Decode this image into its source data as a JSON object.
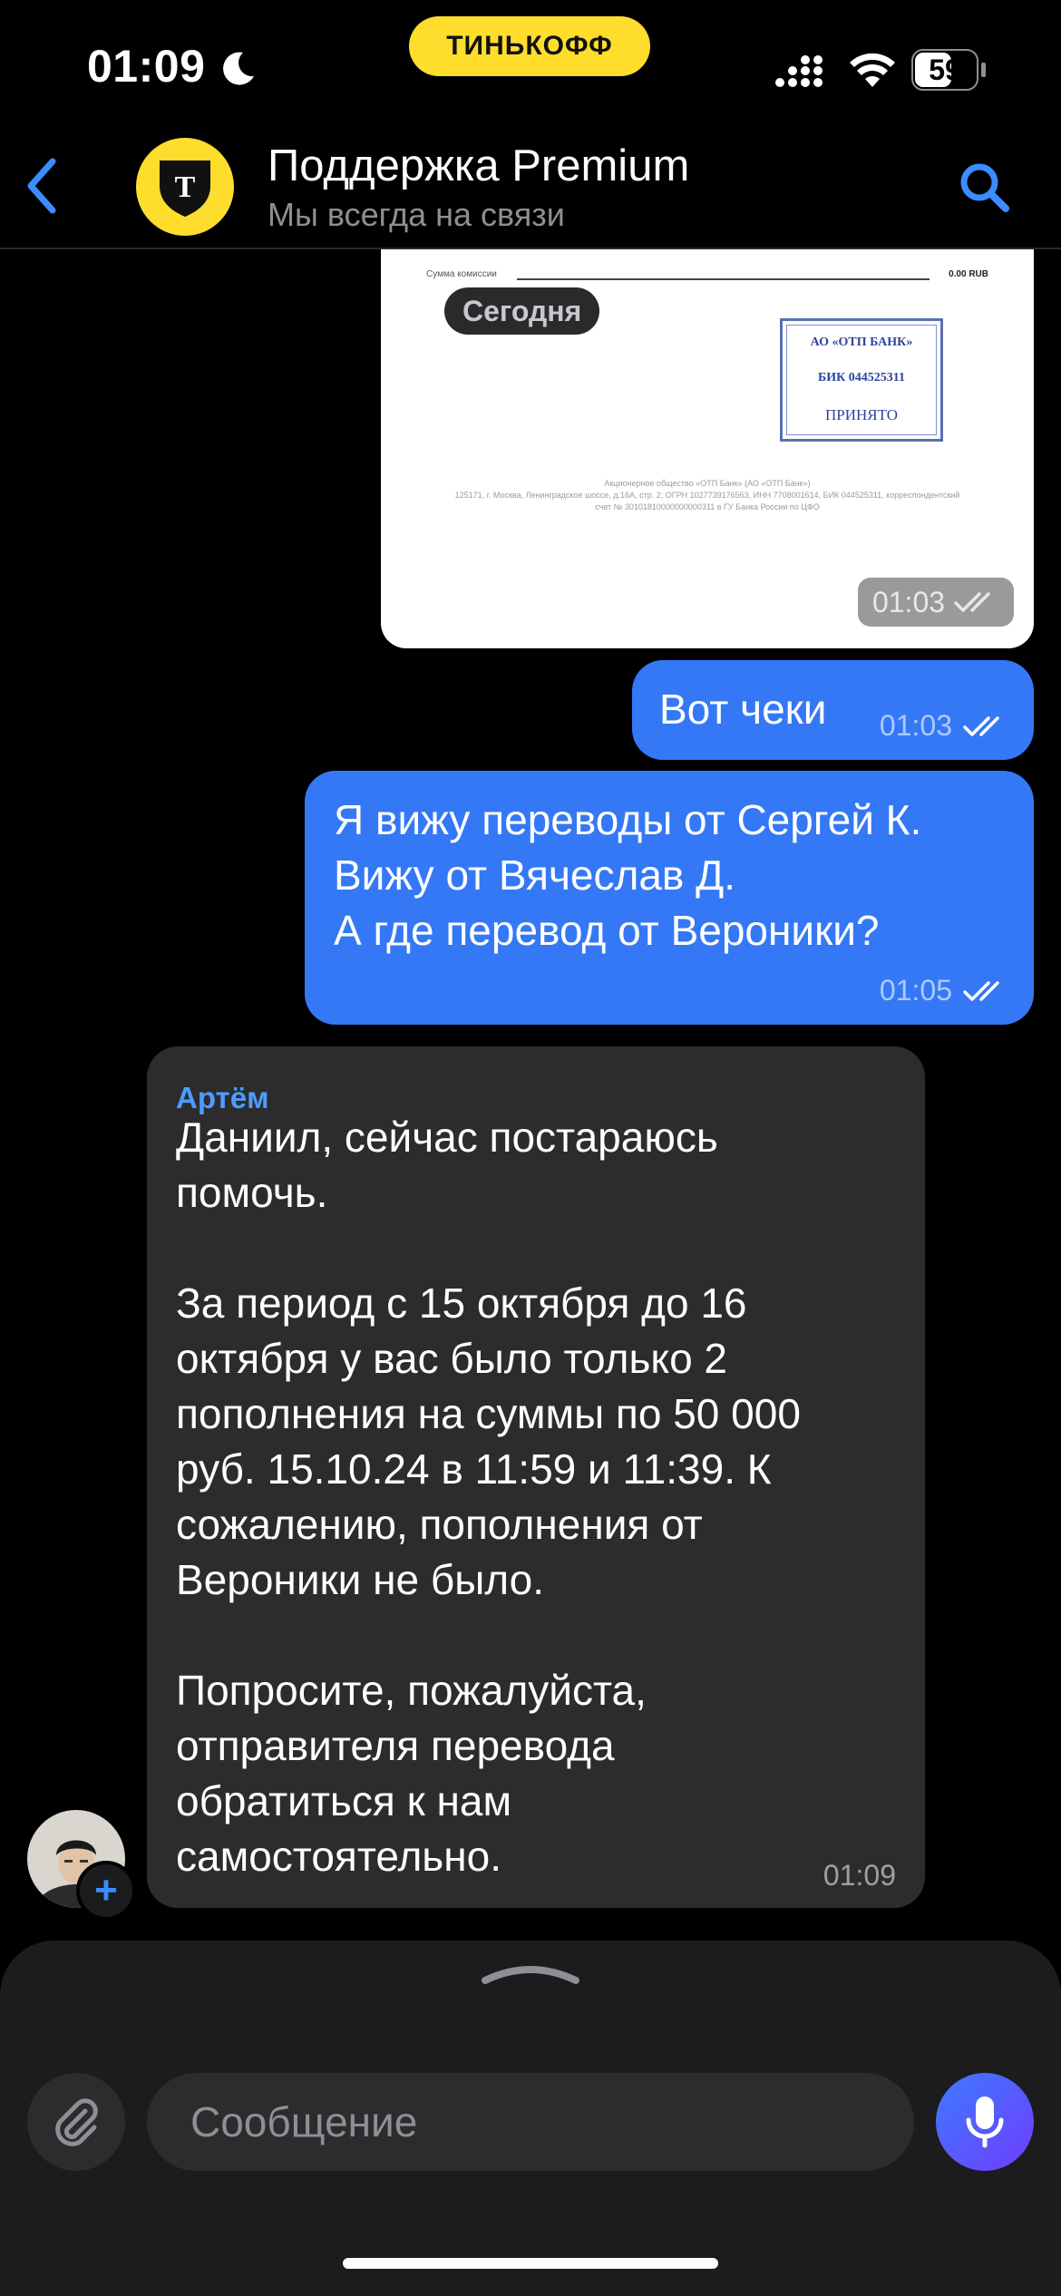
{
  "status_bar": {
    "time": "01:09",
    "brand": "ТИНЬКОФФ",
    "battery": "59"
  },
  "header": {
    "title": "Поддержка Premium",
    "subtitle": "Мы всегда на связи",
    "logo_letter": "T",
    "logo_color": "#FFDD2D"
  },
  "receipt": {
    "line_label": "Сумма комиссии",
    "line_value": "0.00 RUB",
    "date_chip": "Сегодня",
    "stamp": [
      "АО «ОТП БАНК»",
      "БИК 044525311",
      "ПРИНЯТО"
    ],
    "footer_lines": [
      "Акционерное общество «ОТП Банк» (АО «ОТП Банк»)",
      "125171, г. Москва, Ленинградское шоссе, д.16А, стр. 2; ОГРН 1027739176563, ИНН 7708001614, БИК 044525311, корреспондентский",
      "счет № 30101810000000000311 в ГУ Банка России по ЦФО"
    ],
    "time": "01:03"
  },
  "messages": [
    {
      "direction": "out",
      "text": "Вот чеки",
      "time": "01:03"
    },
    {
      "direction": "out",
      "text": "Я вижу переводы от Сергей К.\nВижу от Вячеслав Д.\nА где перевод от Вероники?",
      "time": "01:05"
    },
    {
      "direction": "in",
      "sender": "Артём",
      "text": "Даниил, сейчас постараюсь\nпомочь.\n\nЗа период с 15 октября до 16\nоктября у вас было только 2\nпополнения на суммы по 50 000\nруб. 15.10.24 в 11:59 и 11:39. К\nсожалению, пополнения от\nВероники не было.\n\nПопросите, пожалуйста,\nотправителя перевода\nобратиться к нам\nсамостоятельно.",
      "time": "01:09"
    }
  ],
  "agent": {
    "add_badge": "+"
  },
  "composer": {
    "placeholder": "Сообщение"
  },
  "colors": {
    "outgoing_bubble": "#3478F6",
    "incoming_bubble": "#2c2c2e",
    "sender_name": "#4c9cff",
    "brand_yellow": "#FFDD2D"
  }
}
